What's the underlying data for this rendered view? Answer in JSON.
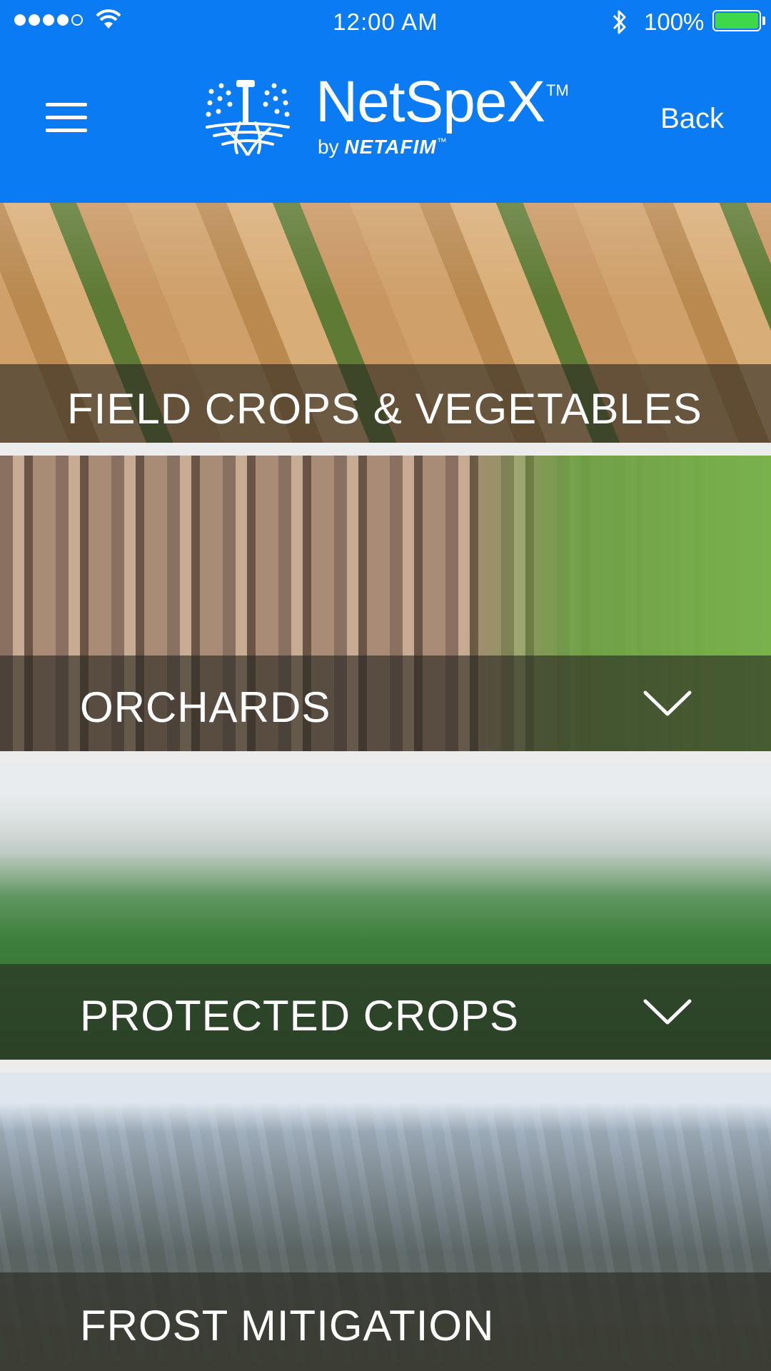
{
  "status_bar": {
    "time": "12:00 AM",
    "battery_percent": "100%",
    "battery_level": 1.0,
    "signal_bars_filled": 4,
    "signal_bars_total": 5,
    "battery_color": "#3fd84b"
  },
  "header": {
    "brand_name": "NetSpeX",
    "brand_tm": "TM",
    "brand_by": "by",
    "brand_company": "NETAFIM",
    "brand_company_tm": "™",
    "back_label": "Back",
    "background_color": "#0a7bf2",
    "menu_icon": "hamburger-icon",
    "logo_icon": "sprinkler-logo-icon"
  },
  "categories": [
    {
      "title": "FIELD CROPS & VEGETABLES",
      "has_chevron": false
    },
    {
      "title": "ORCHARDS",
      "has_chevron": true,
      "chevron_icon": "chevron-down-icon"
    },
    {
      "title": "PROTECTED CROPS",
      "has_chevron": true,
      "chevron_icon": "chevron-down-icon"
    },
    {
      "title": "FROST MITIGATION",
      "has_chevron": false
    }
  ]
}
